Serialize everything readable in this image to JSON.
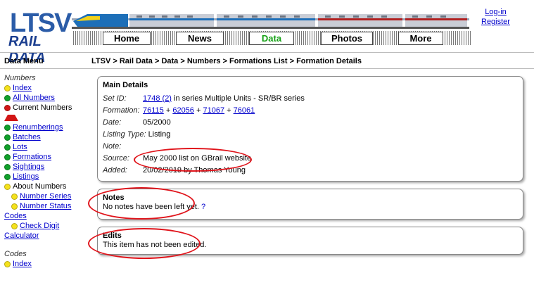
{
  "header": {
    "logo_top": "LTSV",
    "logo_bottom": "RAIL DATA",
    "nav": [
      {
        "label": "Home",
        "active": false
      },
      {
        "label": "News",
        "active": false
      },
      {
        "label": "Data",
        "active": true
      },
      {
        "label": "Photos",
        "active": false
      },
      {
        "label": "More",
        "active": false
      }
    ],
    "login": "Log-in",
    "register": "Register"
  },
  "sidebar": {
    "title": "Data Menu",
    "section_numbers": "Numbers",
    "items": [
      {
        "label": "Index",
        "dot": "yellow",
        "link": true
      },
      {
        "label": "All Numbers",
        "dot": "green",
        "link": true
      },
      {
        "label": "Current Numbers",
        "dot": "red",
        "link": false
      },
      {
        "label": "",
        "dot": "warning",
        "link": false
      },
      {
        "label": "Renumberings",
        "dot": "green",
        "link": true
      },
      {
        "label": "Batches",
        "dot": "green",
        "link": true
      },
      {
        "label": "Lots",
        "dot": "green",
        "link": true
      },
      {
        "label": "Formations",
        "dot": "green",
        "link": true
      },
      {
        "label": "Sightings",
        "dot": "green",
        "link": true
      },
      {
        "label": "Listings",
        "dot": "green",
        "link": true
      },
      {
        "label": "About Numbers",
        "dot": "yellow",
        "link": false
      },
      {
        "label": "Number Series",
        "dot": "yellow",
        "link": true,
        "indent": true
      },
      {
        "label": "Number Status",
        "dot": "yellow",
        "link": true,
        "indent": true
      }
    ],
    "codes_link": "Codes",
    "check_digit_1": "Check Digit",
    "check_digit_2": "Calculator",
    "section_codes": "Codes",
    "codes_index": "Index"
  },
  "breadcrumb": "LTSV > Rail Data > Data > Numbers > Formations List > Formation Details",
  "main_details": {
    "heading": "Main Details",
    "set_id_label": "Set ID:",
    "set_id_link": "1748 (2)",
    "set_id_rest": " in series Multiple Units - SR/BR series",
    "formation_label": "Formation:",
    "formation": [
      "76115",
      "62056",
      "71067",
      "76061"
    ],
    "formation_sep": " + ",
    "date_label": "Date:",
    "date": "05/2000",
    "listing_label": "Listing Type:",
    "listing": "Listing",
    "note_label": "Note:",
    "note": "",
    "source_label": "Source:",
    "source": "May 2000 list on GBrail website",
    "added_label": "Added:",
    "added": "20/02/2019 by Thomas Young"
  },
  "notes": {
    "heading": "Notes",
    "text": "No notes have been left yet.",
    "help": "?"
  },
  "edits": {
    "heading": "Edits",
    "text": "This item has not been edited."
  },
  "colors": {
    "link": "#0000cc",
    "annotation": "#e0141b",
    "active_nav": "#14a014"
  }
}
